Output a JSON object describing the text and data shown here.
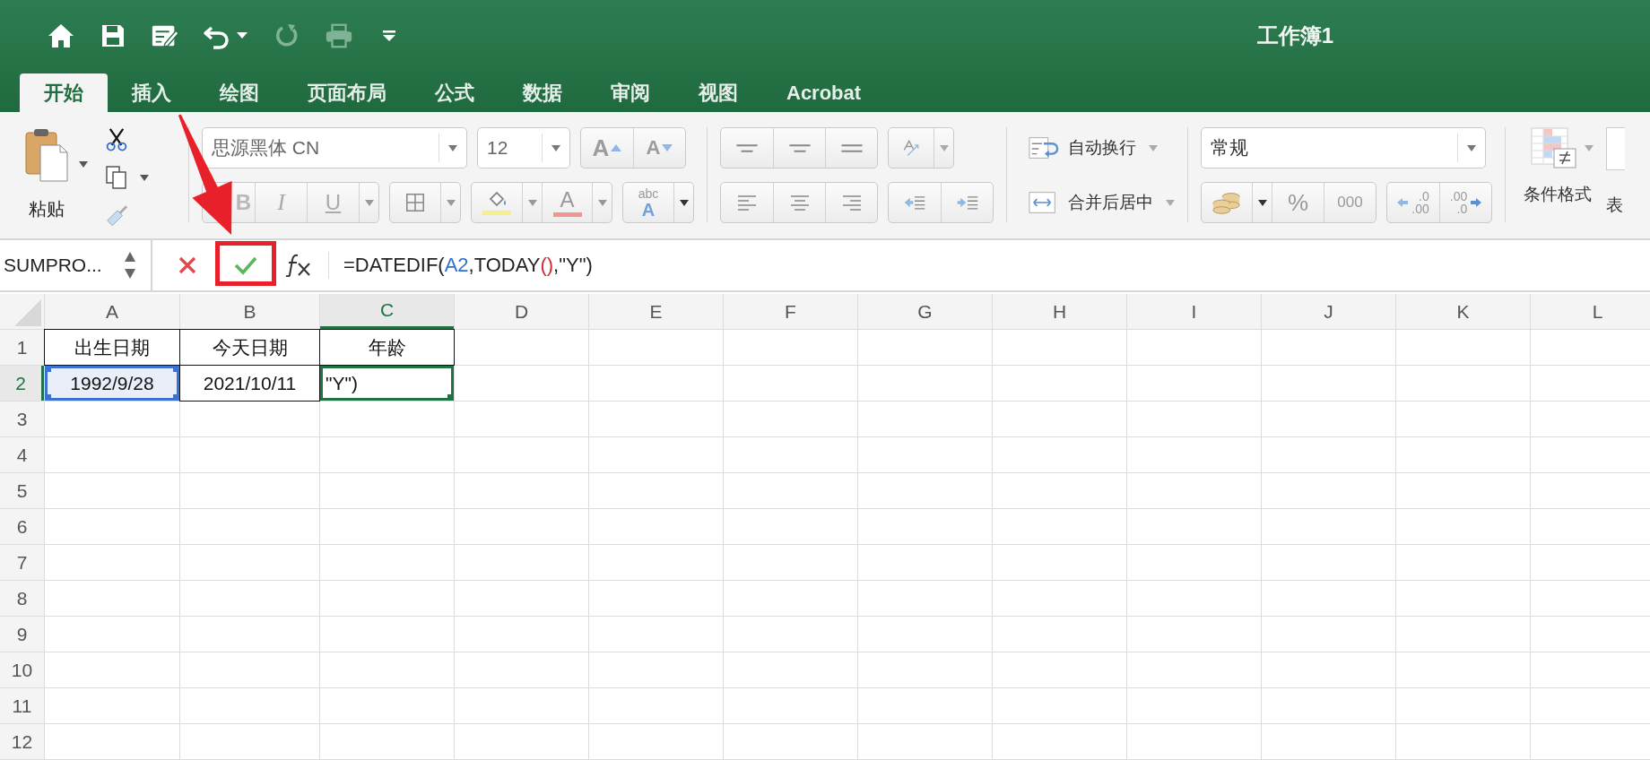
{
  "window": {
    "title": "工作簿1"
  },
  "tabs": [
    {
      "label": "开始",
      "selected": true
    },
    {
      "label": "插入",
      "selected": false
    },
    {
      "label": "绘图",
      "selected": false
    },
    {
      "label": "页面布局",
      "selected": false
    },
    {
      "label": "公式",
      "selected": false
    },
    {
      "label": "数据",
      "selected": false
    },
    {
      "label": "审阅",
      "selected": false
    },
    {
      "label": "视图",
      "selected": false
    },
    {
      "label": "Acrobat",
      "selected": false
    }
  ],
  "ribbon": {
    "paste_label": "粘贴",
    "font_name": "思源黑体 CN",
    "font_size": "12",
    "grow_font": "A",
    "shrink_font": "A",
    "bold": "B",
    "italic": "I",
    "underline": "U",
    "font_color": "A",
    "phonetic": "abc",
    "phonetic_letter": "A",
    "wrap_text": "自动换行",
    "merge_center": "合并后居中",
    "number_format": "常规",
    "percent": "%",
    "comma": "000",
    "decimal_left": [
      ".0",
      ".00"
    ],
    "decimal_right": [
      ".00",
      ".0"
    ],
    "conditional_format": "条件格式",
    "next_label": "表"
  },
  "formula_bar": {
    "name_box": "SUMPRO...",
    "formula": [
      {
        "text": "=DATEDIF(",
        "color": "#222222"
      },
      {
        "text": "A2",
        "color": "#2f6fd0"
      },
      {
        "text": ",TODAY",
        "color": "#222222"
      },
      {
        "text": "()",
        "color": "#d0282e"
      },
      {
        "text": ",\"Y\")",
        "color": "#222222"
      }
    ]
  },
  "sheet": {
    "columns": [
      {
        "label": "A",
        "selected": false
      },
      {
        "label": "B",
        "selected": false
      },
      {
        "label": "C",
        "selected": true
      },
      {
        "label": "D",
        "selected": false
      },
      {
        "label": "E",
        "selected": false
      },
      {
        "label": "F",
        "selected": false
      },
      {
        "label": "G",
        "selected": false
      },
      {
        "label": "H",
        "selected": false
      },
      {
        "label": "I",
        "selected": false
      },
      {
        "label": "J",
        "selected": false
      },
      {
        "label": "K",
        "selected": false
      },
      {
        "label": "L",
        "selected": false
      }
    ],
    "rows": [
      {
        "label": "1",
        "selected": false,
        "cells": [
          {
            "text": "出生日期",
            "selected": false,
            "referenced": false
          },
          {
            "text": "今天日期",
            "selected": false,
            "referenced": false
          },
          {
            "text": "年龄",
            "selected": false,
            "referenced": false
          }
        ]
      },
      {
        "label": "2",
        "selected": true,
        "cells": [
          {
            "text": "1992/9/28",
            "selected": false,
            "referenced": true
          },
          {
            "text": "2021/10/11",
            "selected": false,
            "referenced": false
          },
          {
            "text": "\"Y\")",
            "selected": true,
            "referenced": false
          }
        ]
      },
      {
        "label": "3",
        "selected": false
      },
      {
        "label": "4",
        "selected": false
      },
      {
        "label": "5",
        "selected": false
      },
      {
        "label": "6",
        "selected": false
      },
      {
        "label": "7",
        "selected": false
      },
      {
        "label": "8",
        "selected": false
      },
      {
        "label": "9",
        "selected": false
      },
      {
        "label": "10",
        "selected": false
      },
      {
        "label": "11",
        "selected": false
      },
      {
        "label": "12",
        "selected": false
      }
    ]
  }
}
